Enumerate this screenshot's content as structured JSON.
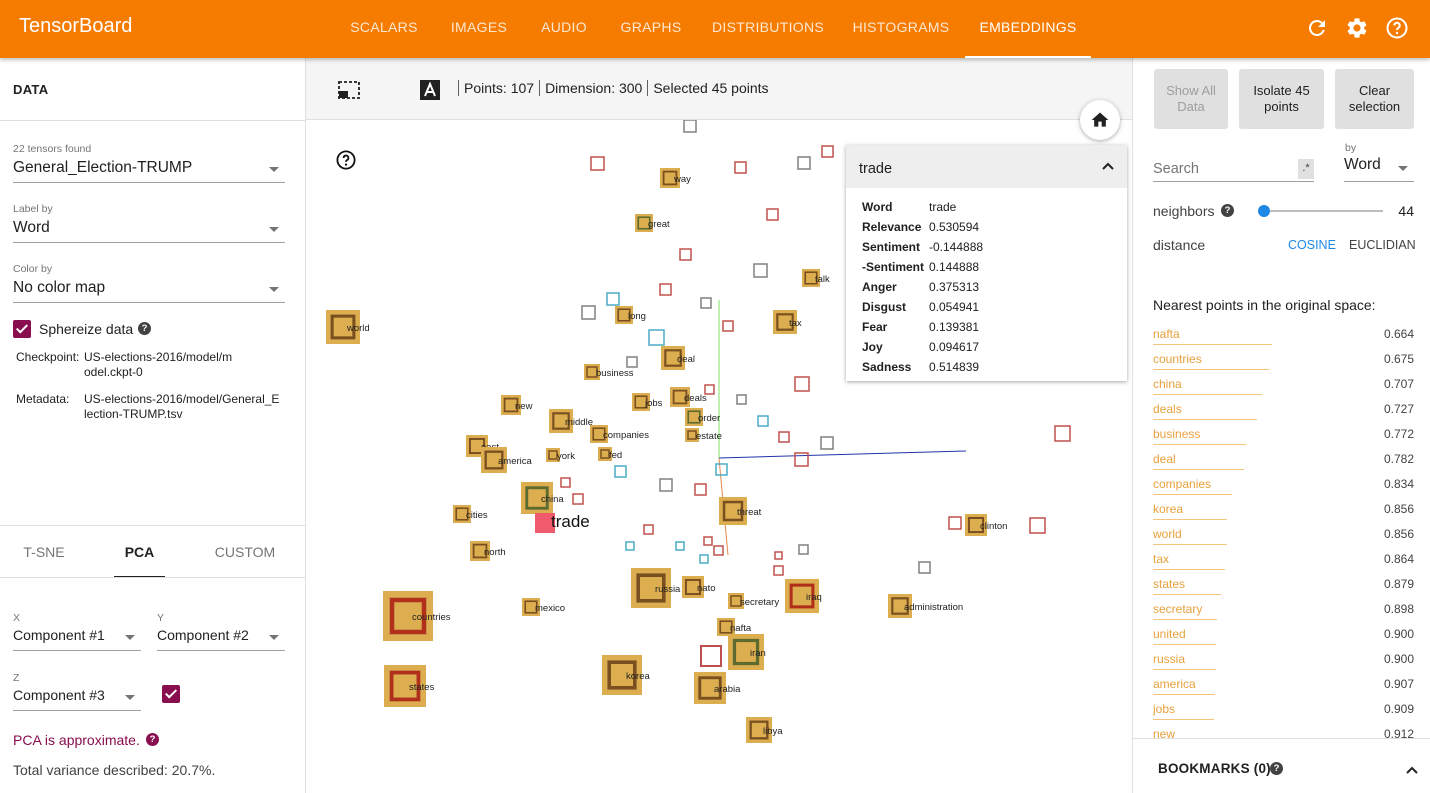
{
  "app": {
    "title": "TensorBoard"
  },
  "nav": {
    "tabs": [
      {
        "label": "SCALARS",
        "active": false
      },
      {
        "label": "IMAGES",
        "active": false
      },
      {
        "label": "AUDIO",
        "active": false
      },
      {
        "label": "GRAPHS",
        "active": false
      },
      {
        "label": "DISTRIBUTIONS",
        "active": false
      },
      {
        "label": "HISTOGRAMS",
        "active": false
      },
      {
        "label": "EMBEDDINGS",
        "active": true
      }
    ],
    "icons": [
      "refresh-icon",
      "settings-gear-icon",
      "help-icon"
    ]
  },
  "data_panel": {
    "title": "DATA",
    "tensors_found": "22 tensors found",
    "tensor_value": "General_Election-TRUMP",
    "label_by_label": "Label by",
    "label_by_value": "Word",
    "color_by_label": "Color by",
    "color_by_value": "No color map",
    "sphereize_label": "Sphereize data",
    "sphereize_checked": true,
    "checkpoint_label": "Checkpoint:",
    "checkpoint_value": "US-elections-2016/model/model.ckpt-0",
    "metadata_label": "Metadata:",
    "metadata_value": "US-elections-2016/model/General_Election-TRUMP.tsv"
  },
  "projection": {
    "tabs": [
      {
        "label": "T-SNE",
        "active": false
      },
      {
        "label": "PCA",
        "active": true
      },
      {
        "label": "CUSTOM",
        "active": false
      }
    ],
    "x_label": "X",
    "x_value": "Component #1",
    "y_label": "Y",
    "y_value": "Component #2",
    "z_label": "Z",
    "z_value": "Component #3",
    "z_enabled": true,
    "approx_note": "PCA is approximate.",
    "variance": "Total variance described: 20.7%."
  },
  "toolbar": {
    "icons": [
      "select-box-icon",
      "night-mode-icon",
      "label-toggle-icon"
    ],
    "points": "Points: 107",
    "dimension": "Dimension: 300",
    "selected": "Selected 45 points"
  },
  "info_card": {
    "title": "trade",
    "rows": [
      {
        "key": "Word",
        "value": "trade"
      },
      {
        "key": "Relevance",
        "value": "0.530594"
      },
      {
        "key": "Sentiment",
        "value": "-0.144888"
      },
      {
        "key": "-Sentiment",
        "value": "0.144888"
      },
      {
        "key": "Anger",
        "value": "0.375313"
      },
      {
        "key": "Disgust",
        "value": "0.054941"
      },
      {
        "key": "Fear",
        "value": "0.139381"
      },
      {
        "key": "Joy",
        "value": "0.094617"
      },
      {
        "key": "Sadness",
        "value": "0.514839"
      }
    ]
  },
  "scatter": {
    "focus_label": "trade",
    "labeled_points": [
      {
        "label": "way",
        "style": "gold-brown"
      },
      {
        "label": "great",
        "style": "gold-green"
      },
      {
        "label": "talk",
        "style": "gold-brown"
      },
      {
        "label": "world",
        "style": "gold-brown"
      },
      {
        "label": "long",
        "style": "gold-brown"
      },
      {
        "label": "tax",
        "style": "gold-brown"
      },
      {
        "label": "deal",
        "style": "gold-brown"
      },
      {
        "label": "business",
        "style": "gold-brown"
      },
      {
        "label": "jobs",
        "style": "gold-brown"
      },
      {
        "label": "deals",
        "style": "gold-brown"
      },
      {
        "label": "order",
        "style": "gold-green"
      },
      {
        "label": "new",
        "style": "gold-brown"
      },
      {
        "label": "middle",
        "style": "gold-brown"
      },
      {
        "label": "companies",
        "style": "gold-brown"
      },
      {
        "label": "estate",
        "style": "gold-brown"
      },
      {
        "label": "east",
        "style": "gold-brown"
      },
      {
        "label": "york",
        "style": "gold-brown"
      },
      {
        "label": "fed",
        "style": "gold-brown"
      },
      {
        "label": "america",
        "style": "gold-brown"
      },
      {
        "label": "china",
        "style": "gold-green"
      },
      {
        "label": "threat",
        "style": "gold-brown"
      },
      {
        "label": "cities",
        "style": "gold-brown"
      },
      {
        "label": "clinton",
        "style": "gold-brown"
      },
      {
        "label": "north",
        "style": "gold-brown"
      },
      {
        "label": "russia",
        "style": "gold-brown"
      },
      {
        "label": "nato",
        "style": "gold-brown"
      },
      {
        "label": "iraq",
        "style": "gold-red"
      },
      {
        "label": "mexico",
        "style": "gold-brown"
      },
      {
        "label": "secretary",
        "style": "gold-brown"
      },
      {
        "label": "administration",
        "style": "gold-brown"
      },
      {
        "label": "countries",
        "style": "gold-red"
      },
      {
        "label": "nafta",
        "style": "gold-brown"
      },
      {
        "label": "iran",
        "style": "gold-green"
      },
      {
        "label": "states",
        "style": "gold-red"
      },
      {
        "label": "korea",
        "style": "gold-brown"
      },
      {
        "label": "arabia",
        "style": "gold-brown"
      },
      {
        "label": "libya",
        "style": "gold-brown"
      }
    ]
  },
  "inspector": {
    "show_all_label": "Show All Data",
    "isolate_label": "Isolate 45 points",
    "clear_label": "Clear selection",
    "search_placeholder": "Search",
    "regex_label": ".*",
    "by_label": "by",
    "by_value": "Word",
    "neighbors_label": "neighbors",
    "neighbors_value": "44",
    "neighbors_fraction": 0.0,
    "distance_label": "distance",
    "cosine_label": "COSINE",
    "euclidian_label": "EUCLIDIAN",
    "distance_metric": "COSINE",
    "nearest_title": "Nearest points in the original space:",
    "nearest": [
      {
        "word": "nafta",
        "distance": "0.664"
      },
      {
        "word": "countries",
        "distance": "0.675"
      },
      {
        "word": "china",
        "distance": "0.707"
      },
      {
        "word": "deals",
        "distance": "0.727"
      },
      {
        "word": "business",
        "distance": "0.772"
      },
      {
        "word": "deal",
        "distance": "0.782"
      },
      {
        "word": "companies",
        "distance": "0.834"
      },
      {
        "word": "korea",
        "distance": "0.856"
      },
      {
        "word": "world",
        "distance": "0.856"
      },
      {
        "word": "tax",
        "distance": "0.864"
      },
      {
        "word": "states",
        "distance": "0.879"
      },
      {
        "word": "secretary",
        "distance": "0.898"
      },
      {
        "word": "united",
        "distance": "0.900"
      },
      {
        "word": "russia",
        "distance": "0.900"
      },
      {
        "word": "america",
        "distance": "0.907"
      },
      {
        "word": "jobs",
        "distance": "0.909"
      },
      {
        "word": "new",
        "distance": "0.912"
      }
    ],
    "bookmarks_label": "BOOKMARKS (0)"
  },
  "colors": {
    "header": "#f57c00",
    "accent": "#880e4f",
    "selected_fill": "#dcae50",
    "focus_fill": "#ef5b6d",
    "link_blue": "#1e88e5",
    "neighbor_text": "#e8a13c"
  }
}
